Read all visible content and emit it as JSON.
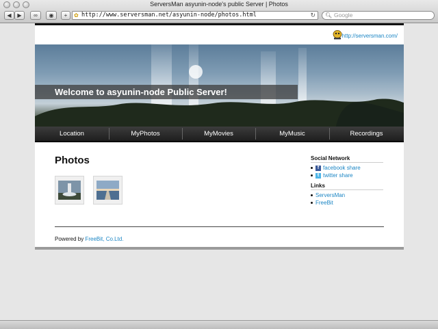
{
  "browser": {
    "window_title": "ServersMan asyunin-node's public Server | Photos",
    "url": "http://www.serversman.net/asyunin-node/photos.html",
    "search_placeholder": "Google"
  },
  "header": {
    "site_link": "http://serversman.com/",
    "welcome": "Welcome to asyunin-node Public Server!"
  },
  "nav": {
    "items": [
      "Location",
      "MyPhotos",
      "MyMovies",
      "MyMusic",
      "Recordings"
    ]
  },
  "main": {
    "heading": "Photos",
    "photos": [
      "fountain-photo",
      "pier-photo"
    ]
  },
  "sidebar": {
    "social_heading": "Social Network",
    "social_items": [
      "facebook share",
      "twitter share"
    ],
    "links_heading": "Links",
    "link_items": [
      "ServersMan",
      "FreeBit"
    ]
  },
  "footer": {
    "prefix": "Powered by",
    "link": "FreeBit, Co.Ltd."
  },
  "colors": {
    "link": "#1a85c4",
    "navbar": "#2a2a2a"
  }
}
